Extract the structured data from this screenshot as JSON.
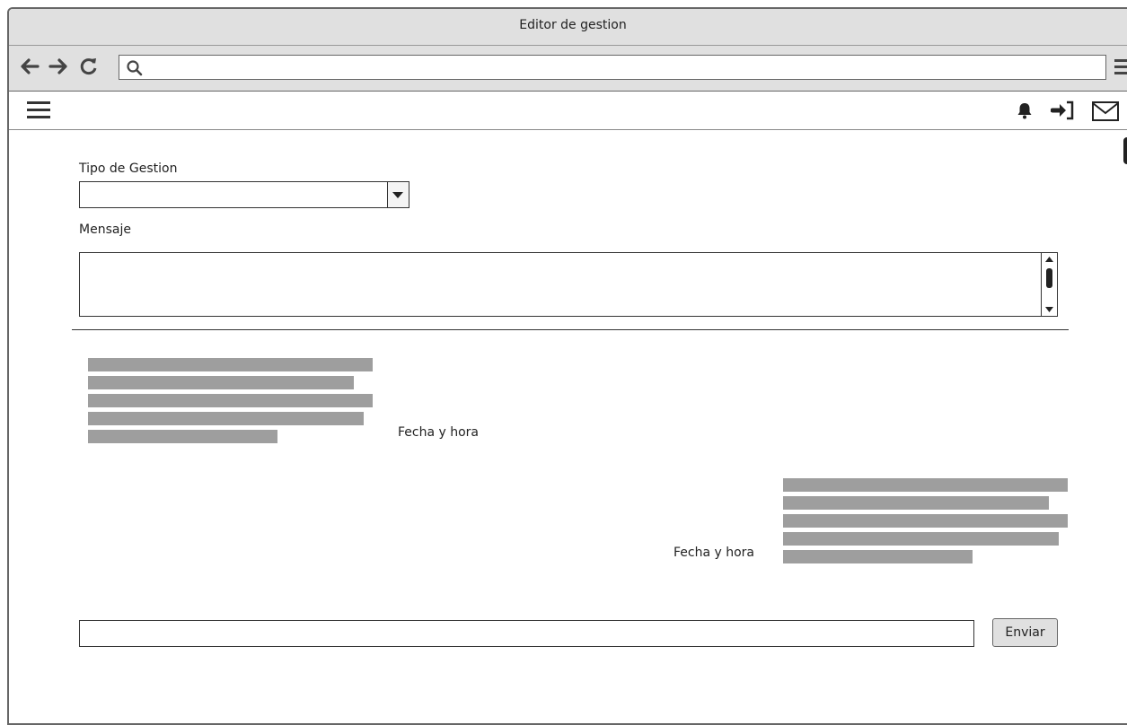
{
  "window": {
    "title": "Editor de gestion"
  },
  "browser": {
    "url": ""
  },
  "form": {
    "tipo_label": "Tipo de Gestion",
    "tipo_value": "",
    "mensaje_label": "Mensaje",
    "mensaje_value": ""
  },
  "chat": {
    "messages": [
      {
        "side": "left",
        "timestamp": "Fecha y hora",
        "line_count": 5
      },
      {
        "side": "right",
        "timestamp": "Fecha y hora",
        "line_count": 5
      }
    ],
    "input_value": "",
    "send_label": "Enviar"
  },
  "icons": [
    "back-arrow-icon",
    "forward-arrow-icon",
    "reload-icon",
    "search-icon",
    "hamburger-menu-icon",
    "bell-icon",
    "sign-in-icon",
    "mail-icon",
    "dropdown-arrow-icon"
  ]
}
